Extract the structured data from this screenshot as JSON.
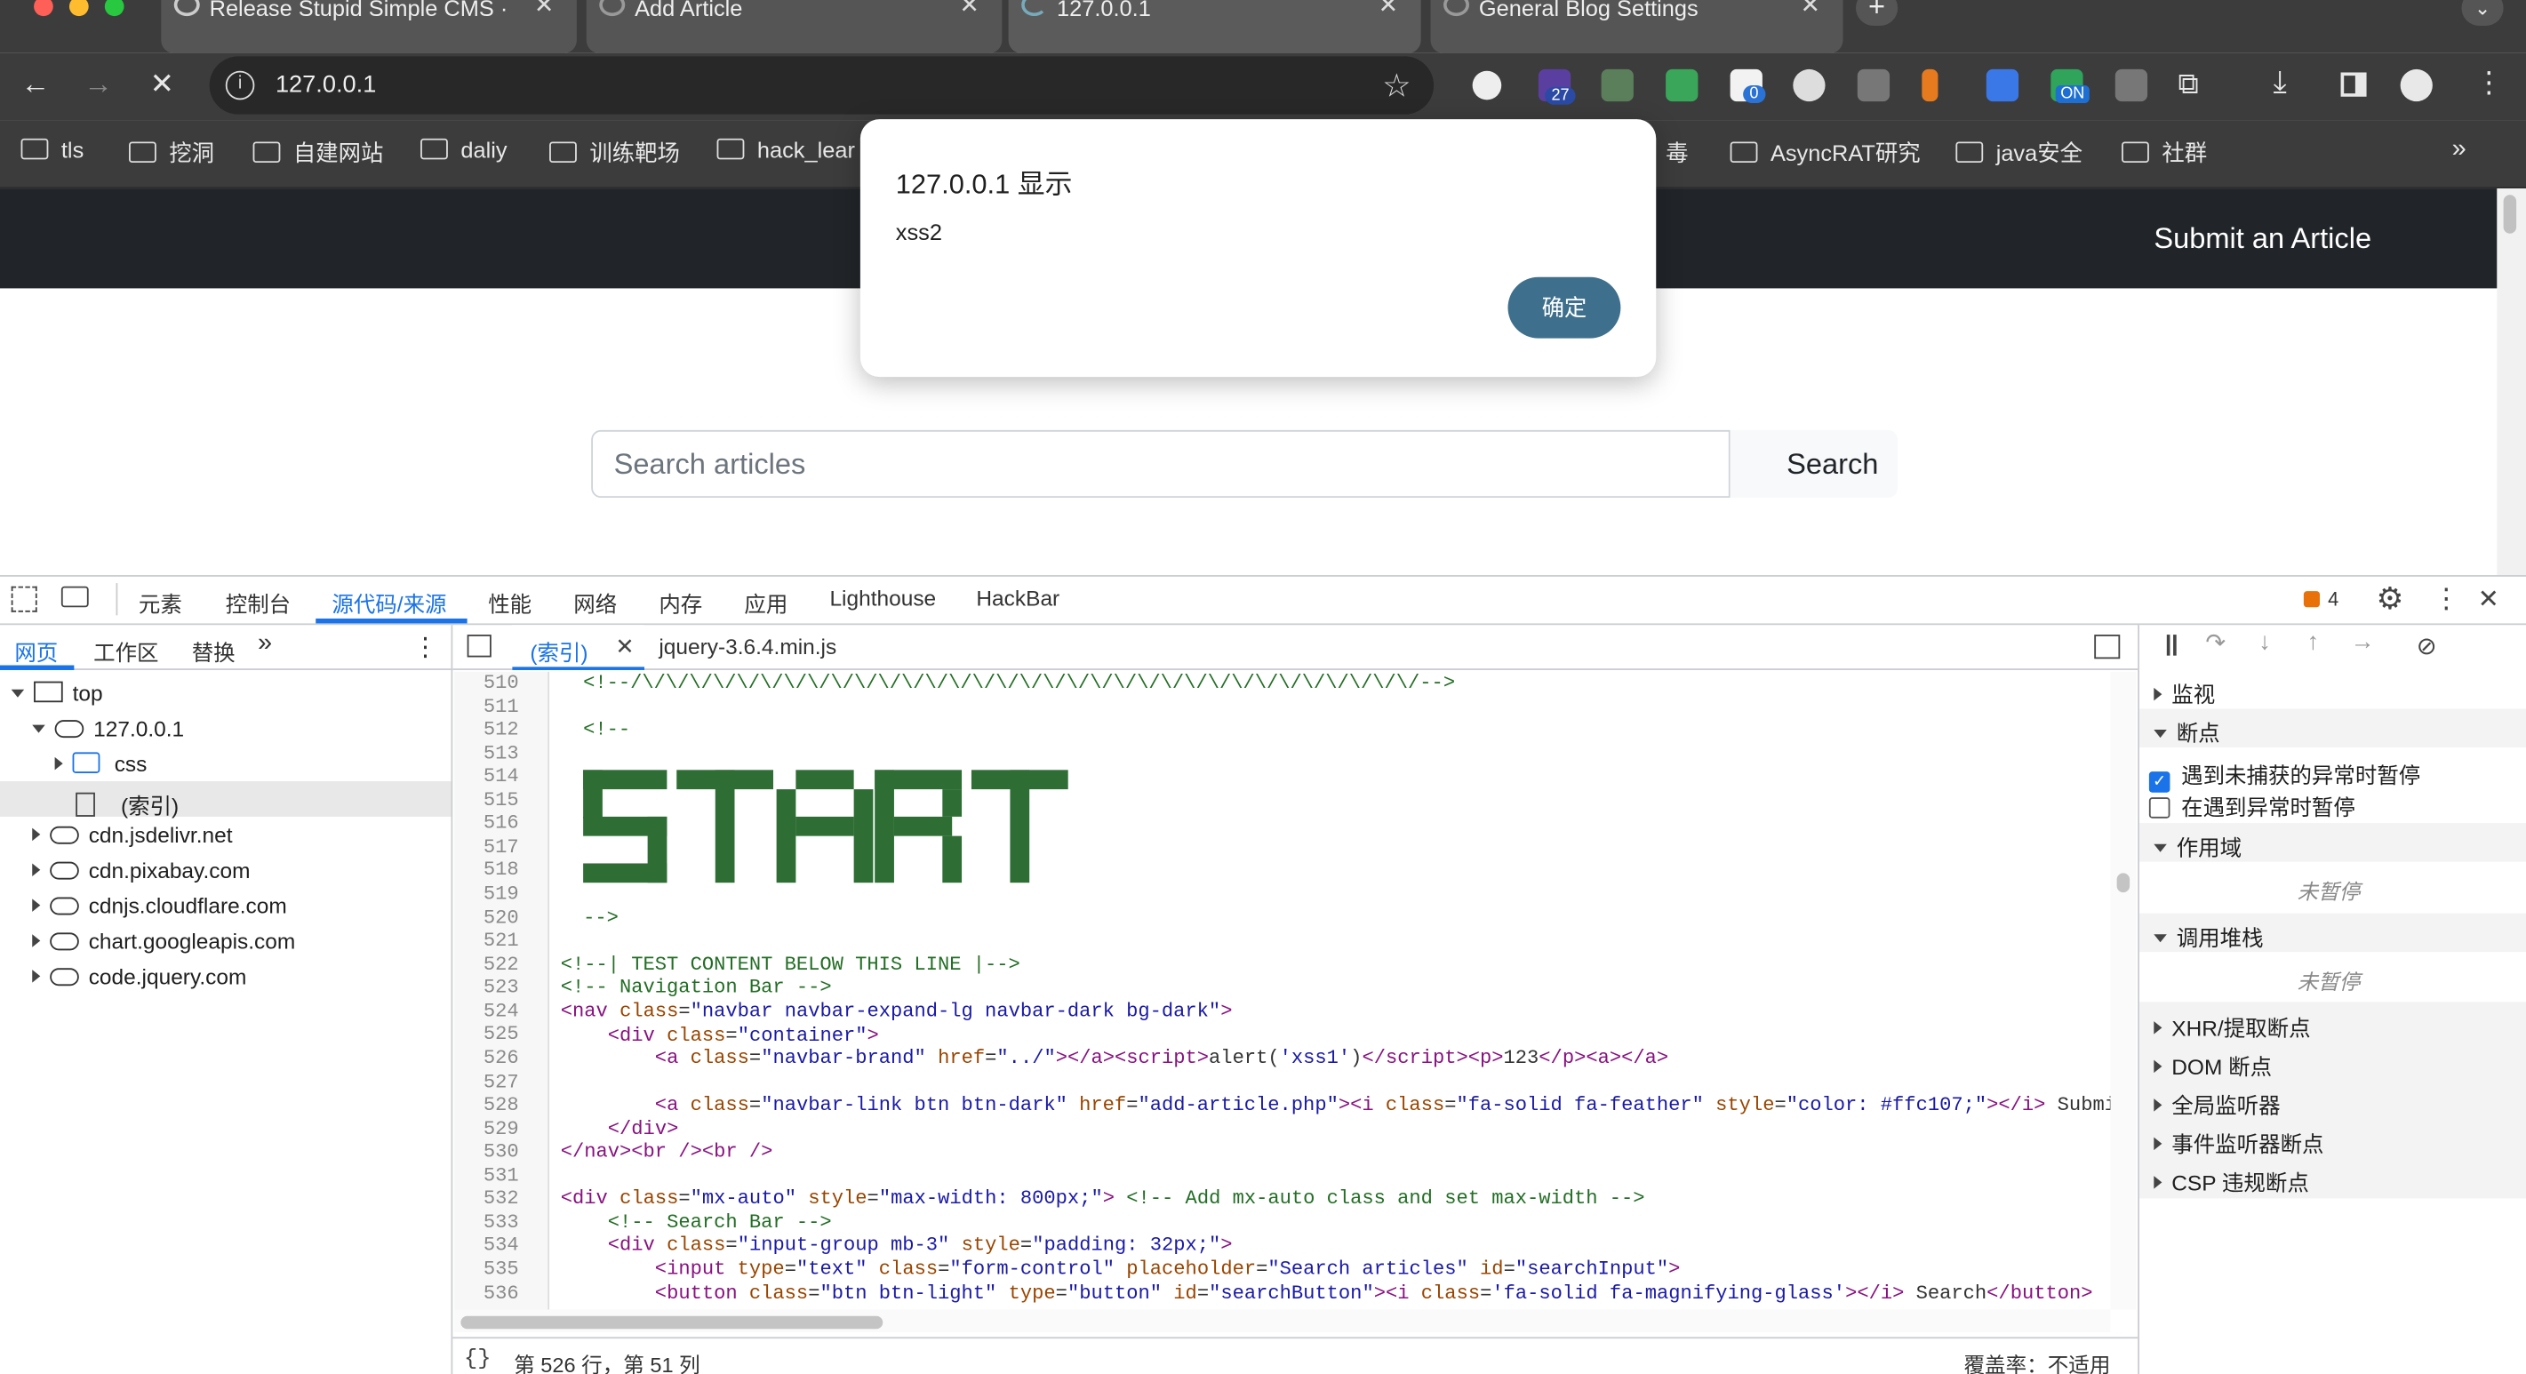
{
  "browser": {
    "tabs": [
      {
        "title": "Release Stupid Simple CMS ·"
      },
      {
        "title": "Add Article"
      },
      {
        "title": "127.0.0.1"
      },
      {
        "title": "General Blog Settings"
      }
    ],
    "address": "127.0.0.1",
    "ext_badges": {
      "b1": "27",
      "b2": "0",
      "b3": "ON"
    },
    "bookmarks": [
      {
        "label": "tls"
      },
      {
        "label": "挖洞"
      },
      {
        "label": "自建网站"
      },
      {
        "label": "daliy"
      },
      {
        "label": "训练靶场"
      },
      {
        "label": "hack_lear"
      },
      {
        "label": "毒"
      },
      {
        "label": "AsyncRAT研究"
      },
      {
        "label": "java安全"
      },
      {
        "label": "社群"
      }
    ]
  },
  "site": {
    "nav_submit": "Submit an Article",
    "search_placeholder": "Search articles",
    "search_button": "Search"
  },
  "dialog": {
    "title": "127.0.0.1 显示",
    "message": "xss2",
    "ok": "确定"
  },
  "devtools": {
    "tabs": [
      "元素",
      "控制台",
      "源代码/来源",
      "性能",
      "网络",
      "内存",
      "应用",
      "Lighthouse",
      "HackBar"
    ],
    "issues_count": "4",
    "nav_tabs": [
      "网页",
      "工作区",
      "替换"
    ],
    "file_tabs": {
      "index": "(索引)",
      "jquery": "jquery-3.6.4.min.js"
    },
    "tree": {
      "top": "top",
      "host": "127.0.0.1",
      "css": "css",
      "index": "(索引)",
      "domains": [
        "cdn.jsdelivr.net",
        "cdn.pixabay.com",
        "cdnjs.cloudflare.com",
        "chart.googleapis.com",
        "code.jquery.com"
      ]
    },
    "line_numbers": [
      "510",
      "511",
      "512",
      "513",
      "514",
      "515",
      "516",
      "517",
      "518",
      "519",
      "520",
      "521",
      "522",
      "523",
      "524",
      "525",
      "526",
      "527",
      "528",
      "529",
      "530",
      "531",
      "532",
      "533",
      "534",
      "535",
      "536"
    ],
    "status_position": "第 526 行，第 51 列",
    "status_coverage": "覆盖率：不适用",
    "right": {
      "watch": "监视",
      "breakpoints": "断点",
      "pause_uncaught": "遇到未捕获的异常时暂停",
      "pause_caught": "在遇到异常时暂停",
      "scope": "作用域",
      "not_paused": "未暂停",
      "callstack": "调用堆栈",
      "xhr": "XHR/提取断点",
      "dom": "DOM 断点",
      "global": "全局监听器",
      "event": "事件监听器断点",
      "csp": "CSP 违规断点"
    }
  },
  "colors": {
    "chrome_dark": "#3c3c3c",
    "nav_dark": "#212529",
    "dialog_button": "#3e6f8c",
    "devtools_accent": "#1a73e8"
  }
}
